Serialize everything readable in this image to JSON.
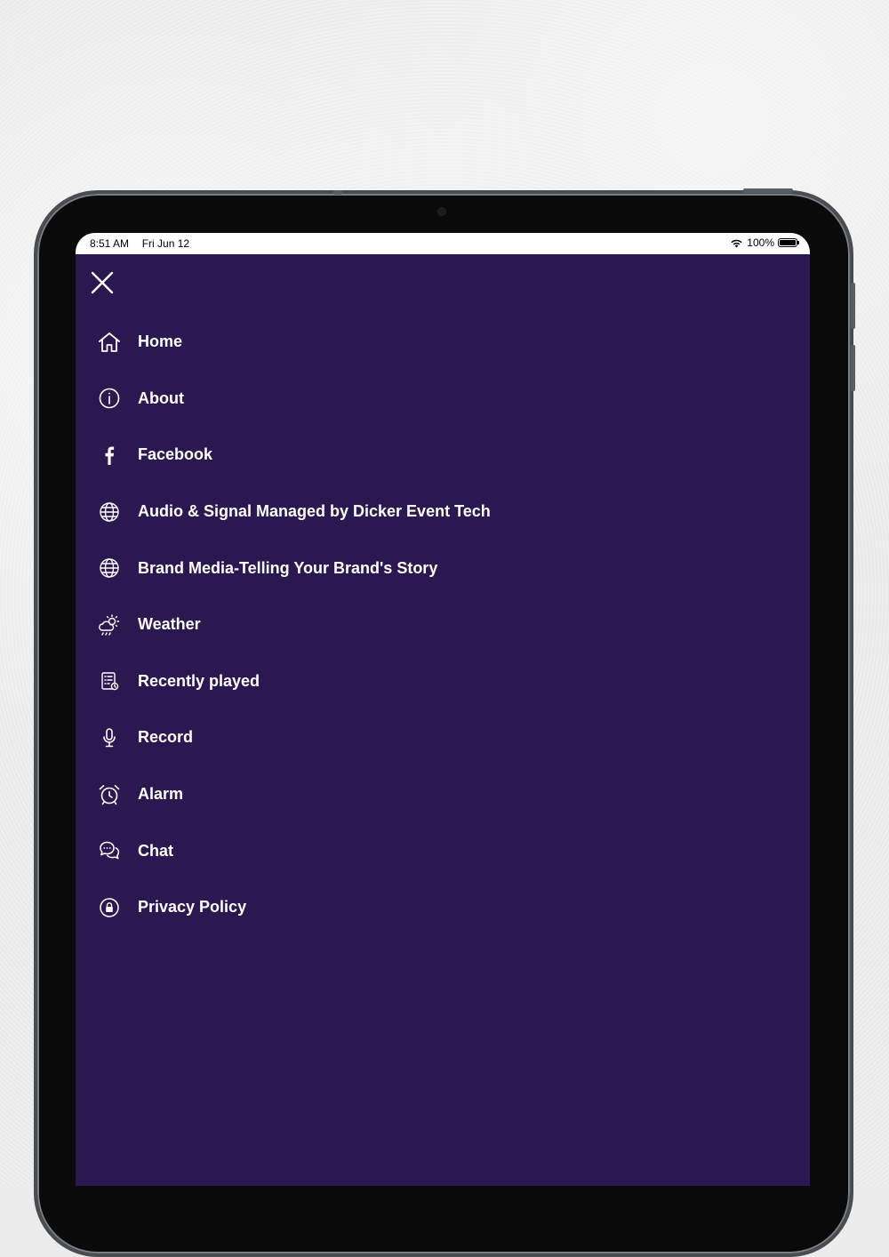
{
  "status_bar": {
    "time": "8:51 AM",
    "date": "Fri Jun 12",
    "battery_text": "100%",
    "battery_level": 1.0
  },
  "theme": {
    "menu_background": "#2c1850",
    "text_color": "#ffffff",
    "status_bar_background": "#ffffff"
  },
  "menu": {
    "close_icon": "close-icon",
    "items": [
      {
        "label": "Home",
        "icon": "home-icon"
      },
      {
        "label": "About",
        "icon": "info-icon"
      },
      {
        "label": "Facebook",
        "icon": "facebook-icon"
      },
      {
        "label": "Audio & Signal Managed by Dicker Event Tech",
        "icon": "globe-icon"
      },
      {
        "label": "Brand Media-Telling Your Brand's Story",
        "icon": "globe-icon"
      },
      {
        "label": "Weather",
        "icon": "weather-icon"
      },
      {
        "label": "Recently played",
        "icon": "recently-played-icon"
      },
      {
        "label": "Record",
        "icon": "microphone-icon"
      },
      {
        "label": "Alarm",
        "icon": "alarm-icon"
      },
      {
        "label": "Chat",
        "icon": "chat-icon"
      },
      {
        "label": "Privacy Policy",
        "icon": "lock-icon"
      }
    ]
  }
}
